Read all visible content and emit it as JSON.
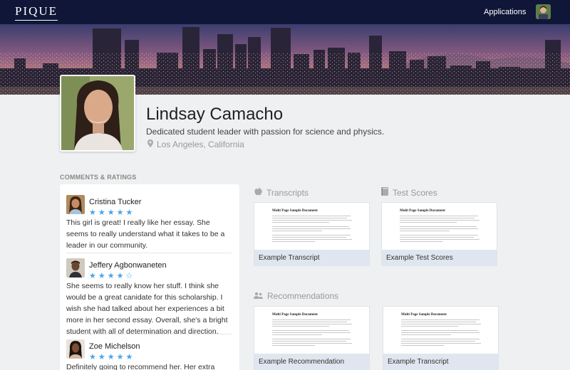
{
  "nav": {
    "logo": "PIQUE",
    "applications_label": "Applications"
  },
  "profile": {
    "name": "Lindsay Camacho",
    "tagline": "Dedicated student leader with passion for science and physics.",
    "location": "Los Angeles, California"
  },
  "comments_section": {
    "title": "COMMENTS & RATINGS",
    "items": [
      {
        "name": "Cristina Tucker",
        "stars": "★★★★★",
        "rating": 5,
        "text": "This girl is great! I really like her essay. She seems to really understand what it takes to be a leader in our community."
      },
      {
        "name": "Jeffery Agbonwaneten",
        "stars": "★★★★☆",
        "rating": 4,
        "text": "She seems to really know her stuff. I think she would be a great canidate for this scholarship. I wish she had talked about her experiences a bit more in her second essay. Overall, she's a bright student with all of determination and direction."
      },
      {
        "name": "Zoe Michelson",
        "stars": "★★★★★",
        "rating": 5,
        "text": "Definitely going to recommend her. Her extra curriculars"
      }
    ]
  },
  "documents": {
    "transcripts": {
      "heading": "Transcripts",
      "card_label": "Example Transcript"
    },
    "test_scores": {
      "heading": "Test Scores",
      "card_label": "Example Test Scores"
    },
    "recommendations": {
      "heading": "Recommendations",
      "cards": [
        "Example Recommendation",
        "Example Transcript"
      ]
    },
    "preview_title": "Multi Page Sample Document"
  },
  "colors": {
    "nav_bg": "#0f1638",
    "star": "#4aa3e8",
    "card_label_bg": "#dfe6ef",
    "page_bg": "#eff0f2"
  },
  "icons": {
    "location": "map-pin-icon",
    "transcripts": "apple-icon",
    "test_scores": "book-icon",
    "recommendations": "people-icon"
  }
}
